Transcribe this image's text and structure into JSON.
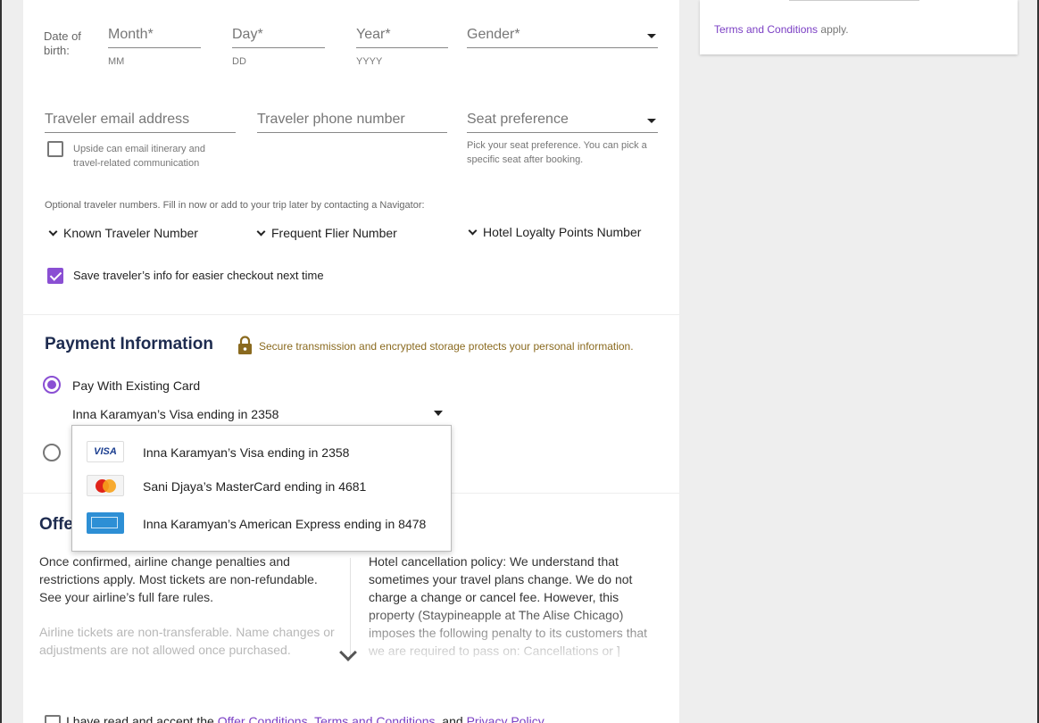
{
  "traveler": {
    "dob_label": "Date of birth:",
    "month_placeholder": "Month*",
    "month_hint": "MM",
    "day_placeholder": "Day*",
    "day_hint": "DD",
    "year_placeholder": "Year*",
    "year_hint": "YYYY",
    "gender_placeholder": "Gender*",
    "email_placeholder": "Traveler email address",
    "phone_placeholder": "Traveler phone number",
    "seat_placeholder": "Seat preference",
    "seat_hint": "Pick your seat preference. You can pick a specific seat after booking.",
    "email_consent": "Upside can email itinerary and travel-related communication",
    "optional_numbers_text": "Optional traveler numbers. Fill in now or add to your trip later by contacting a Navigator:",
    "known_traveler": "Known Traveler Number",
    "frequent_flier": "Frequent Flier Number",
    "hotel_loyalty": "Hotel Loyalty Points Number",
    "save_info": "Save traveler’s info for easier checkout next time"
  },
  "payment": {
    "title": "Payment Information",
    "secure_text": "Secure transmission and encrypted storage protects your personal information.",
    "pay_existing_label": "Pay With Existing Card",
    "selected_card": "Inna Karamyan’s Visa ending in 2358",
    "card_options": [
      {
        "name": "Inna Karamyan’s Visa ending in 2358",
        "brand": "visa",
        "logo_text": "VISA"
      },
      {
        "name": "Sani Djaya’s MasterCard ending in 4681",
        "brand": "mastercard"
      },
      {
        "name": "Inna Karamyan’s American Express ending in 8478",
        "brand": "amex"
      }
    ]
  },
  "offer": {
    "title_partial": "Offe",
    "airline_text_1": "Once confirmed, airline change penalties and restrictions apply. Most tickets are non-refundable. See your airline’s full fare rules.",
    "airline_text_2": "Airline tickets are non-transferable. Name changes or adjustments are not allowed once purchased.",
    "hotel_text": "Hotel cancellation policy: We understand that sometimes your travel plans change. We do not charge a change or cancel fee. However, this property (Staypineapple at The Alise Chicago) imposes the following penalty to its customers that we are required to pass on: Cancellations or ]",
    "accept_prefix": "I have read and accept the ",
    "offer_conditions": "Offer Conditions",
    "comma": ", ",
    "terms": "Terms and Conditions",
    "and": ", and ",
    "privacy": "Privacy Policy"
  },
  "sidebar": {
    "terms_link": "Terms and Conditions",
    "terms_suffix": " apply."
  },
  "colors": {
    "accent": "#8a4fd3",
    "heading": "#1d2b4f",
    "secure": "#8a6a1f"
  }
}
